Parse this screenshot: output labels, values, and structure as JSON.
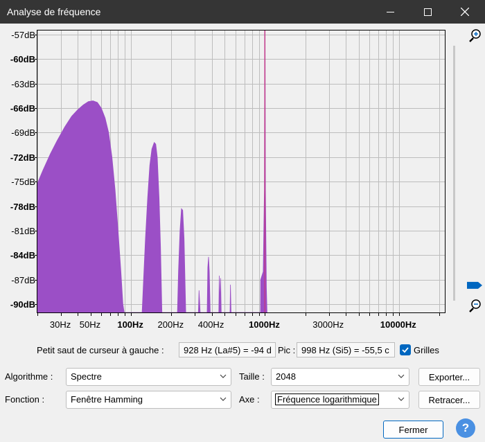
{
  "window": {
    "title": "Analyse de fréquence"
  },
  "chart_data": {
    "type": "area",
    "x_scale": "log",
    "xlim": [
      20,
      22000
    ],
    "ylim": [
      -91,
      -56.5
    ],
    "y_ticks": [
      -57,
      -60,
      -63,
      -66,
      -69,
      -72,
      -75,
      -78,
      -81,
      -84,
      -87,
      -90
    ],
    "y_tick_labels": [
      "-57dB",
      "-60dB",
      "-63dB",
      "-66dB",
      "-69dB",
      "-72dB",
      "-75dB",
      "-78dB",
      "-81dB",
      "-84dB",
      "-87dB",
      "-90dB"
    ],
    "x_ticks": [
      {
        "value": 30,
        "label": "30Hz",
        "bold": false
      },
      {
        "value": 50,
        "label": "50Hz",
        "bold": false
      },
      {
        "value": 100,
        "label": "100Hz",
        "bold": true
      },
      {
        "value": 200,
        "label": "200Hz",
        "bold": false
      },
      {
        "value": 400,
        "label": "400Hz",
        "bold": false
      },
      {
        "value": 1000,
        "label": "1000Hz",
        "bold": true
      },
      {
        "value": 3000,
        "label": "3000Hz",
        "bold": false
      },
      {
        "value": 10000,
        "label": "10000Hz",
        "bold": true
      }
    ],
    "grid": true,
    "fill_color": "#9b4fc6",
    "peak_color": "#c23a8a",
    "spectrum": [
      [
        20,
        -75.2
      ],
      [
        22,
        -73.6
      ],
      [
        25,
        -71.6
      ],
      [
        28,
        -70
      ],
      [
        32,
        -68.3
      ],
      [
        36,
        -67
      ],
      [
        40,
        -66.2
      ],
      [
        44,
        -65.6
      ],
      [
        48,
        -65.2
      ],
      [
        52,
        -65.1
      ],
      [
        56,
        -65.3
      ],
      [
        60,
        -66
      ],
      [
        64,
        -67.2
      ],
      [
        68,
        -69
      ],
      [
        72,
        -72
      ],
      [
        76,
        -76
      ],
      [
        80,
        -81
      ],
      [
        84,
        -86
      ],
      [
        87,
        -90
      ],
      [
        89,
        -91
      ],
      [
        121,
        -91
      ],
      [
        124,
        -87
      ],
      [
        128,
        -82
      ],
      [
        133,
        -77
      ],
      [
        138,
        -73
      ],
      [
        143,
        -71
      ],
      [
        149,
        -70.2
      ],
      [
        153,
        -70.4
      ],
      [
        157,
        -72
      ],
      [
        162,
        -77
      ],
      [
        166,
        -83
      ],
      [
        170,
        -91
      ],
      [
        222,
        -91
      ],
      [
        226,
        -86
      ],
      [
        232,
        -81
      ],
      [
        238,
        -78.3
      ],
      [
        243,
        -78.5
      ],
      [
        249,
        -82
      ],
      [
        256,
        -91
      ],
      [
        318,
        -91
      ],
      [
        322,
        -88.3
      ],
      [
        328,
        -91
      ],
      [
        370,
        -91
      ],
      [
        374,
        -85.5
      ],
      [
        379,
        -84.2
      ],
      [
        384,
        -86
      ],
      [
        390,
        -91
      ],
      [
        452,
        -91
      ],
      [
        456,
        -86.5
      ],
      [
        461,
        -90
      ],
      [
        466,
        -86.8
      ],
      [
        471,
        -91
      ],
      [
        548,
        -91
      ],
      [
        552,
        -87.6
      ],
      [
        558,
        -91
      ],
      [
        926,
        -91
      ],
      [
        928,
        -87
      ],
      [
        970,
        -86
      ],
      [
        990,
        -76
      ],
      [
        996,
        -58
      ],
      [
        998,
        -56.5
      ],
      [
        1001,
        -58
      ],
      [
        1008,
        -76
      ],
      [
        1025,
        -88
      ],
      [
        1035,
        -91
      ]
    ]
  },
  "cursor_info": {
    "label": "Petit saut de curseur à gauche :",
    "value": "928 Hz (La#5) = -94 d",
    "peak_label": "Pic :",
    "peak_value": "998 Hz (Si5) = -55,5 c"
  },
  "grids": {
    "label": "Grilles",
    "checked": true
  },
  "controls": {
    "algorithm_label": "Algorithme :",
    "algorithm_value": "Spectre",
    "size_label": "Taille :",
    "size_value": "2048",
    "function_label": "Fonction :",
    "function_value": "Fenêtre Hamming",
    "axis_label": "Axe :",
    "axis_value": "Fréquence logarithmique"
  },
  "buttons": {
    "export": "Exporter...",
    "replot": "Retracer...",
    "close": "Fermer",
    "help": "?"
  },
  "zoom": {
    "zoom_in_icon": "zoom-in-icon",
    "zoom_out_icon": "zoom-out-icon",
    "slider_level": 0.94
  }
}
